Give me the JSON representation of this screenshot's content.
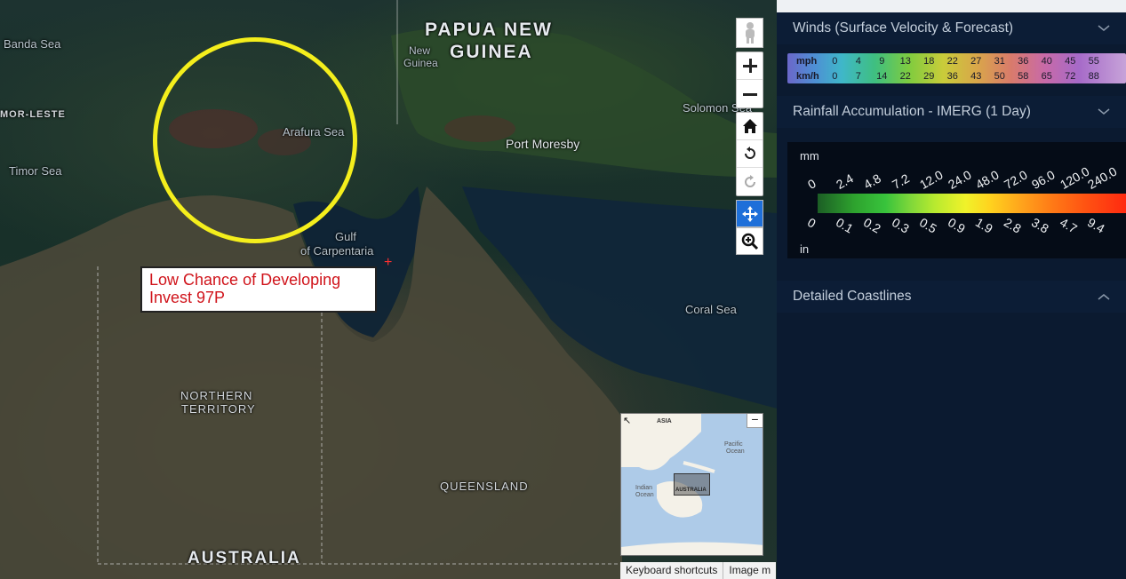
{
  "map": {
    "labels": {
      "banda_sea": "Banda Sea",
      "timor_leste": "MOR-LESTE",
      "timor_sea": "Timor Sea",
      "png": "PAPUA NEW",
      "png2": "GUINEA",
      "new_guinea": "New",
      "new_guinea2": "Guinea",
      "solomon": "Solomon Sea",
      "arafura": "Arafura Sea",
      "port_moresby": "Port Moresby",
      "gulf": "Gulf",
      "gulf2": "of Carpentaria",
      "coral_sea": "Coral Sea",
      "northern": "NORTHERN",
      "territory": "TERRITORY",
      "queensland": "QUEENSLAND",
      "australia": "AUSTRALIA"
    },
    "callout": {
      "line1": "Low Chance of Developing",
      "line2": "Invest 97P"
    },
    "overview": {
      "asia": "ASIA",
      "pacific": "Pacific",
      "pacific2": "Ocean",
      "indian": "Indian",
      "indian2": "Ocean",
      "australia": "AUSTRALIA"
    },
    "attribution": {
      "keyboard": "Keyboard shortcuts",
      "image": "Image m"
    },
    "colors": {
      "circle": "#f4ee1c",
      "callout_text": "#d0141b",
      "active_tool": "#1e6fd9"
    },
    "controls": [
      "pegman-icon",
      "zoom-in-icon",
      "zoom-out-icon",
      "home-icon",
      "rotate-left-icon",
      "rotate-right-icon",
      "pan-icon",
      "zoom-box-icon"
    ]
  },
  "panel": {
    "winds": {
      "title": "Winds (Surface Velocity & Forecast)",
      "mph_label": "mph",
      "kmh_label": "km/h",
      "mph": [
        "0",
        "4",
        "9",
        "13",
        "18",
        "22",
        "27",
        "31",
        "36",
        "40",
        "45",
        "55"
      ],
      "kmh": [
        "0",
        "7",
        "14",
        "22",
        "29",
        "36",
        "43",
        "50",
        "58",
        "65",
        "72",
        "88"
      ]
    },
    "rainfall": {
      "title": "Rainfall Accumulation - IMERG (1 Day)",
      "mm_label": "mm",
      "in_label": "in",
      "mm_ticks": [
        "0",
        "2.4",
        "4.8",
        "7.2",
        "12.0",
        "24.0",
        "48.0",
        "72.0",
        "96.0",
        "120.0",
        "240.0"
      ],
      "in_ticks": [
        "0",
        "0.1",
        "0.2",
        "0.3",
        "0.5",
        "0.9",
        "1.9",
        "2.8",
        "3.8",
        "4.7",
        "9.4"
      ]
    },
    "coastlines": {
      "title": "Detailed Coastlines"
    }
  }
}
